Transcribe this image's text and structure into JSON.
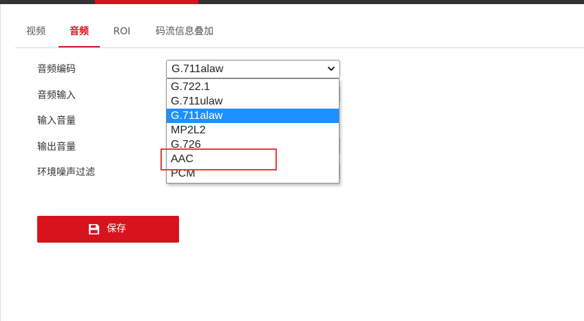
{
  "tabs": [
    {
      "label": "视频"
    },
    {
      "label": "音频"
    },
    {
      "label": "ROI"
    },
    {
      "label": "码流信息叠加"
    }
  ],
  "form": {
    "audio_encoding_label": "音频编码",
    "audio_input_label": "音频输入",
    "input_volume_label": "输入音量",
    "output_volume_label": "输出音量",
    "noise_filter_label": "环境噪声过滤"
  },
  "encoding_select": {
    "value": "G.711alaw",
    "options": [
      "G.722.1",
      "G.711ulaw",
      "G.711alaw",
      "MP2L2",
      "G.726",
      "AAC",
      "PCM"
    ],
    "selected_option": "G.711alaw",
    "highlighted_option": "AAC"
  },
  "save_button": {
    "label": "保存",
    "icon": "save-icon"
  },
  "colors": {
    "accent": "#d7141e",
    "selection": "#1e90ff",
    "highlight_box": "#e8383d"
  }
}
